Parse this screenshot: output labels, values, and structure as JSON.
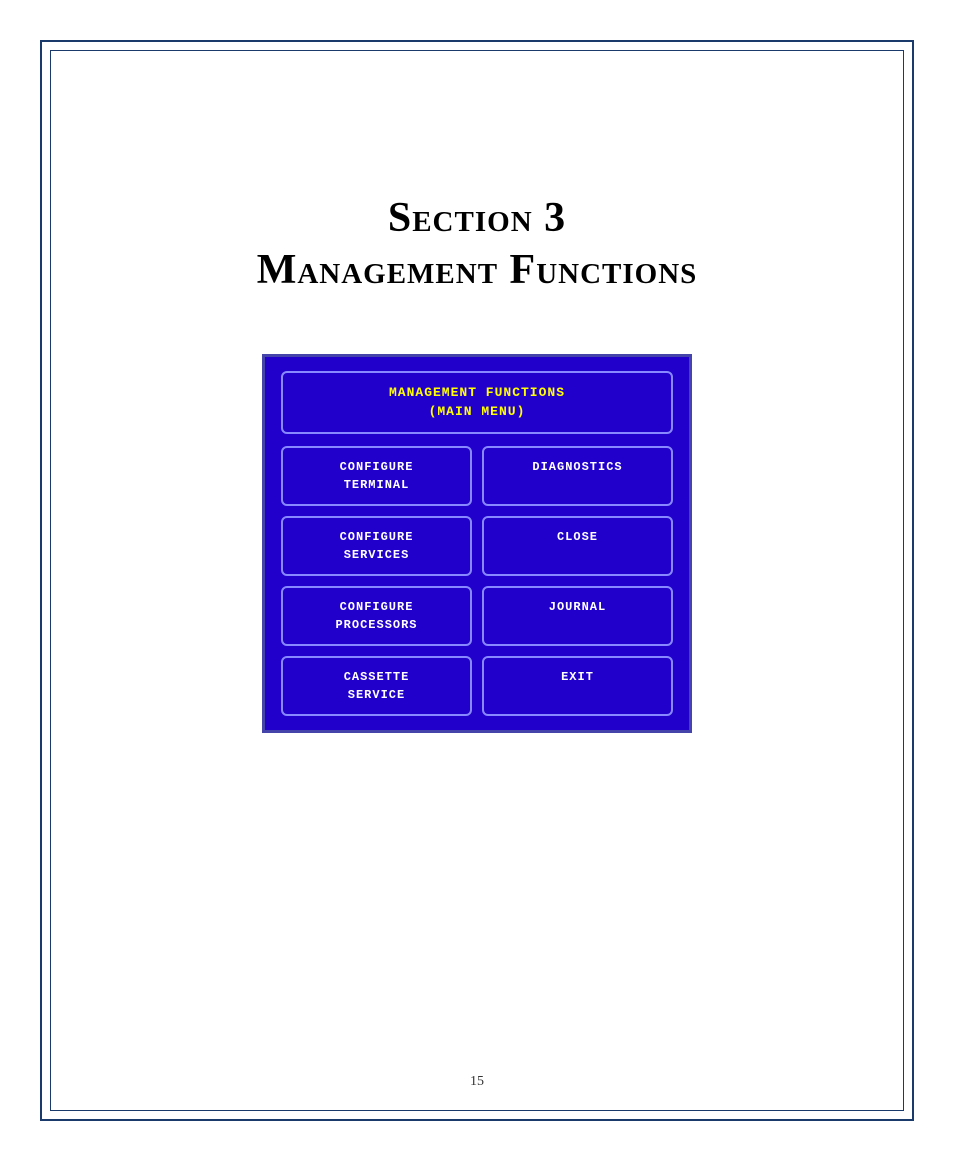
{
  "page": {
    "number": "15"
  },
  "section": {
    "title_line1": "Section 3",
    "title_line2": "Management Functions"
  },
  "screen": {
    "menu_title_line1": "MANAGEMENT  FUNCTIONS",
    "menu_title_line2": "(MAIN MENU)",
    "buttons": [
      {
        "id": "configure-terminal",
        "label_line1": "CONFIGURE",
        "label_line2": "TERMINAL",
        "col": 1
      },
      {
        "id": "diagnostics",
        "label_line1": "DIAGNOSTICS",
        "label_line2": "",
        "col": 2
      },
      {
        "id": "configure-services",
        "label_line1": "CONFIGURE",
        "label_line2": "SERVICES",
        "col": 1
      },
      {
        "id": "close",
        "label_line1": "CLOSE",
        "label_line2": "",
        "col": 2
      },
      {
        "id": "configure-processors",
        "label_line1": "CONFIGURE",
        "label_line2": "PROCESSORS",
        "col": 1
      },
      {
        "id": "journal",
        "label_line1": "JOURNAL",
        "label_line2": "",
        "col": 2
      },
      {
        "id": "cassette-service",
        "label_line1": "CASSETTE",
        "label_line2": "SERVICE",
        "col": 1
      },
      {
        "id": "exit",
        "label_line1": "EXIT",
        "label_line2": "",
        "col": 2
      }
    ]
  }
}
